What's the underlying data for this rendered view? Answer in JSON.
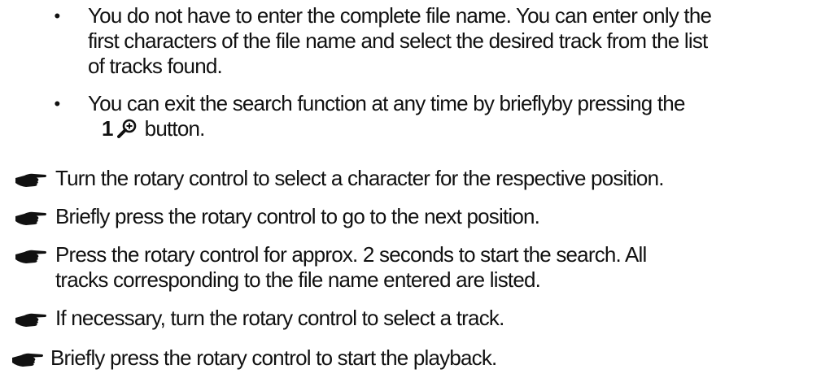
{
  "notes": [
    {
      "lines": [
        "You do not have to enter the complete file name. You can enter only the",
        "first characters of the file name and select the desired track from the list",
        "of  tracks found."
      ]
    },
    {
      "lines": [
        "You can exit the search function at any time by brieflyby  pressing the"
      ],
      "button_number": "1",
      "button_icon": "zoom-search-icon",
      "button_suffix": "button."
    }
  ],
  "steps": [
    {
      "lines": [
        "Turn the rotary control  to select a character for the respective position."
      ]
    },
    {
      "lines": [
        "Briefly press the rotary control  to go to the next position."
      ]
    },
    {
      "lines": [
        "Press the rotary control  for approx. 2 seconds to start the search. All",
        "tracks corresponding to the file name entered are listed."
      ]
    },
    {
      "lines": [
        "If  necessary,  turn  the  rotary  control to select a track."
      ]
    },
    {
      "lines": [
        "Briefly press the rotary control  to start the playback."
      ]
    }
  ],
  "step_icon": "pointing-hand-icon"
}
